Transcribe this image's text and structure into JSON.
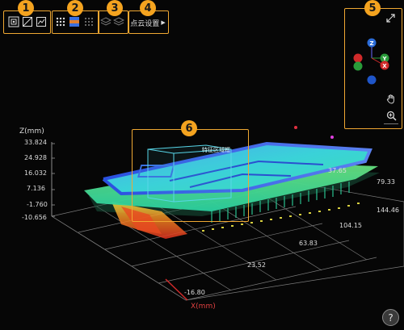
{
  "callouts": {
    "c1": "1",
    "c2": "2",
    "c3": "3",
    "c4": "4",
    "c5": "5",
    "c6": "6"
  },
  "toolbar": {
    "point_settings_label": "点云设置"
  },
  "roi_label": "特征区域框",
  "axes": {
    "z_title": "Z(mm)",
    "z_ticks": [
      "33.824",
      "24.928",
      "16.032",
      "7.136",
      "-1.760",
      "-10.656"
    ],
    "x_title": "X(mm)",
    "x_ticks": [
      "-16.80",
      "23.52",
      "63.83",
      "104.15",
      "144.46"
    ],
    "y_ticks": [
      "37.65",
      "79.33"
    ]
  },
  "nav_gizmo": {
    "z": "Z",
    "y": "Y",
    "x": "X"
  },
  "help": "?",
  "colors": {
    "accent_orange": "#f4a31f",
    "roi_box": "#f0a832",
    "axis_x": "#d02a2a",
    "axis_y": "#2a9b3a",
    "axis_z": "#2a6bd8",
    "cloud_low": "#f04020",
    "cloud_mid": "#3ad890",
    "cloud_high": "#3a60e0"
  }
}
